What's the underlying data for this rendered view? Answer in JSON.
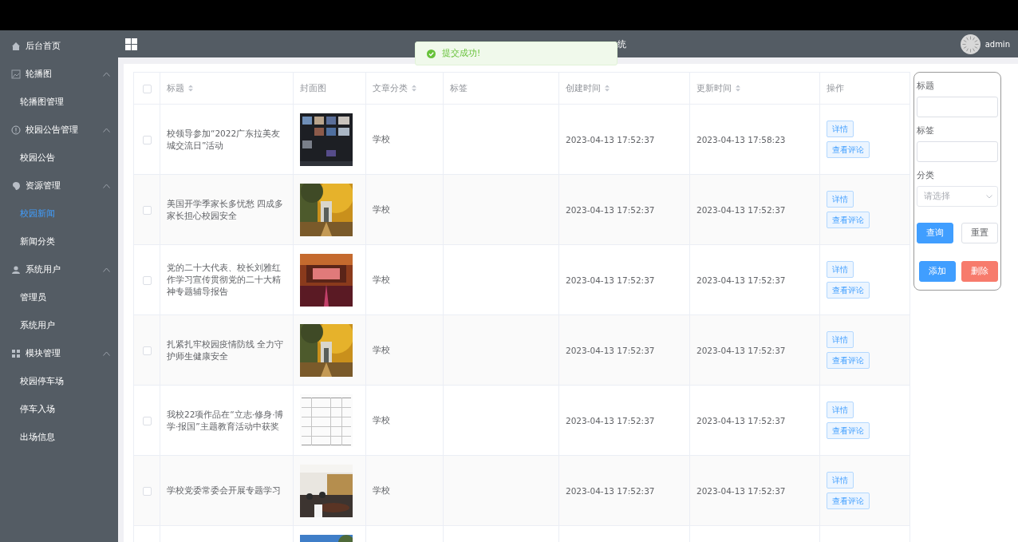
{
  "sidebar": {
    "items": [
      {
        "label": "后台首页"
      },
      {
        "label": "轮播图",
        "expanded": true,
        "children": [
          {
            "label": "轮播图管理",
            "selected": false
          }
        ]
      },
      {
        "label": "校园公告管理",
        "expanded": true,
        "children": [
          {
            "label": "校园公告",
            "selected": false
          }
        ]
      },
      {
        "label": "资源管理",
        "expanded": true,
        "children": [
          {
            "label": "校园新闻",
            "selected": true
          },
          {
            "label": "新闻分类",
            "selected": false
          }
        ]
      },
      {
        "label": "系统用户",
        "expanded": true,
        "children": [
          {
            "label": "管理员",
            "selected": false
          },
          {
            "label": "系统用户",
            "selected": false
          }
        ]
      },
      {
        "label": "模块管理",
        "expanded": true,
        "children": [
          {
            "label": "校园停车场",
            "selected": false
          },
          {
            "label": "停车入场",
            "selected": false
          },
          {
            "label": "出场信息",
            "selected": false
          }
        ]
      }
    ]
  },
  "header": {
    "title": "统",
    "user": "admin"
  },
  "toast": {
    "message": "提交成功!"
  },
  "table": {
    "select_all": false,
    "columns": [
      {
        "label": "标题",
        "sortable": true
      },
      {
        "label": "封面图",
        "sortable": false
      },
      {
        "label": "文章分类",
        "sortable": true
      },
      {
        "label": "标签",
        "sortable": false
      },
      {
        "label": "创建时间",
        "sortable": true
      },
      {
        "label": "更新时间",
        "sortable": true
      },
      {
        "label": "操作",
        "sortable": false
      }
    ],
    "rows": [
      {
        "checked": false,
        "title": "校领导参加“2022广东拉美友城交流日”活动",
        "cover": {
          "kind": "picture"
        },
        "category": "学校",
        "created": "2023-04-13 17:52:37",
        "updated": "2023-04-13 17:58:23",
        "actions": [
          "详情",
          "查看评论"
        ]
      },
      {
        "checked": false,
        "title": "美国开学季家长多忧愁 四成多家长担心校园安全",
        "cover": {
          "kind": "picture"
        },
        "category": "学校",
        "created": "2023-04-13 17:52:37",
        "updated": "2023-04-13 17:52:37",
        "actions": [
          "详情",
          "查看评论"
        ]
      },
      {
        "checked": false,
        "title": "党的二十大代表、校长刘雅红作学习宣传贯彻党的二十大精神专题辅导报告",
        "cover": {
          "kind": "picture"
        },
        "category": "学校",
        "created": "2023-04-13 17:52:37",
        "updated": "2023-04-13 17:52:37",
        "actions": [
          "详情",
          "查看评论"
        ]
      },
      {
        "checked": false,
        "title": "扎紧扎牢校园疫情防线 全力守护师生健康安全",
        "cover": {
          "kind": "picture"
        },
        "category": "学校",
        "created": "2023-04-13 17:52:37",
        "updated": "2023-04-13 17:52:37",
        "actions": [
          "详情",
          "查看评论"
        ]
      },
      {
        "checked": false,
        "title": "我校22项作品在“立志·修身·博学·报国”主题教育活动中获奖",
        "cover": {
          "kind": "picture"
        },
        "category": "学校",
        "created": "2023-04-13 17:52:37",
        "updated": "2023-04-13 17:52:37",
        "actions": [
          "详情",
          "查看评论"
        ]
      },
      {
        "checked": false,
        "title": "学校党委常委会开展专题学习",
        "cover": {
          "kind": "picture"
        },
        "category": "学校",
        "created": "2023-04-13 17:52:37",
        "updated": "2023-04-13 17:52:37",
        "actions": [
          "详情",
          "查看评论"
        ]
      },
      {
        "cover": {
          "kind": "picture"
        }
      }
    ]
  },
  "search_panel": {
    "fields": [
      {
        "label": "标题",
        "kind": "text"
      },
      {
        "label": "标签",
        "kind": "text"
      },
      {
        "label": "分类",
        "kind": "select",
        "placeholder": "请选择"
      }
    ],
    "buttons": [
      {
        "label": "查询",
        "kind": "primary"
      },
      {
        "label": "重置",
        "kind": "plain"
      },
      {
        "label": "添加",
        "kind": "primary"
      },
      {
        "label": "删除",
        "kind": "danger"
      }
    ]
  }
}
